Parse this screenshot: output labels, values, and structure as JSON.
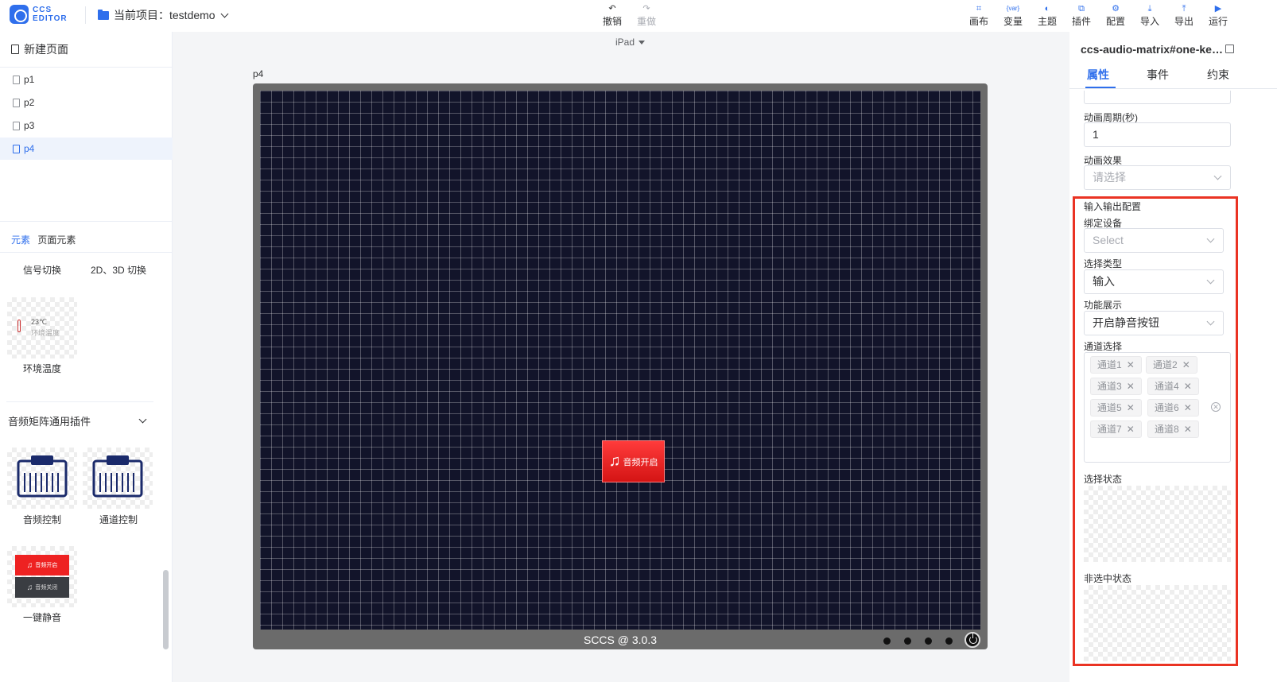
{
  "app": {
    "logo_line1": "CCS",
    "logo_line2": "EDITOR",
    "project_label": "当前项目：",
    "project_name": "testdemo"
  },
  "toolbar": {
    "undo": "撤销",
    "redo": "重做",
    "right": [
      {
        "label": "画布",
        "icon": "canvas-icon"
      },
      {
        "label": "变量",
        "icon": "var-icon",
        "glyph": "{var}"
      },
      {
        "label": "主题",
        "icon": "palette-icon"
      },
      {
        "label": "插件",
        "icon": "plugin-icon"
      },
      {
        "label": "配置",
        "icon": "gear-icon"
      },
      {
        "label": "导入",
        "icon": "import-icon"
      },
      {
        "label": "导出",
        "icon": "export-icon"
      },
      {
        "label": "运行",
        "icon": "play-icon"
      }
    ]
  },
  "sidebar": {
    "new_page": "新建页面",
    "pages": [
      "p1",
      "p2",
      "p3",
      "p4"
    ],
    "active_page": "p4",
    "element_tabs": [
      "元素",
      "页面元素"
    ],
    "items_top": [
      "信号切换",
      "2D、3D 切换"
    ],
    "env_temp": {
      "label": "环境温度",
      "temp": "23℃",
      "caption": "环境温度"
    },
    "section_title": "音频矩阵通用插件",
    "plugins": [
      "音频控制",
      "通道控制",
      "一键静音"
    ],
    "mute_thumb": {
      "on": "音频开启",
      "off": "音频关闭"
    }
  },
  "canvas": {
    "device": "iPad",
    "page_name": "p4",
    "footer": "SCCS @ 3.0.3",
    "widget_label": "音频开启"
  },
  "props": {
    "component_title": "ccs-audio-matrix#one-key-mute",
    "tabs": [
      "属性",
      "事件",
      "约束"
    ],
    "active_tab": "属性",
    "anim_period_label": "动画周期(秒)",
    "anim_period_value": "1",
    "anim_effect_label": "动画效果",
    "anim_effect_placeholder": "请选择",
    "io_title": "输入输出配置",
    "bind_device_label": "绑定设备",
    "bind_device_placeholder": "Select",
    "select_type_label": "选择类型",
    "select_type_value": "输入",
    "func_label": "功能展示",
    "func_value": "开启静音按钮",
    "channel_label": "通道选择",
    "channels": [
      "通道1",
      "通道2",
      "通道3",
      "通道4",
      "通道5",
      "通道6",
      "通道7",
      "通道8"
    ],
    "selected_state_label": "选择状态",
    "unselected_state_label": "非选中状态"
  }
}
